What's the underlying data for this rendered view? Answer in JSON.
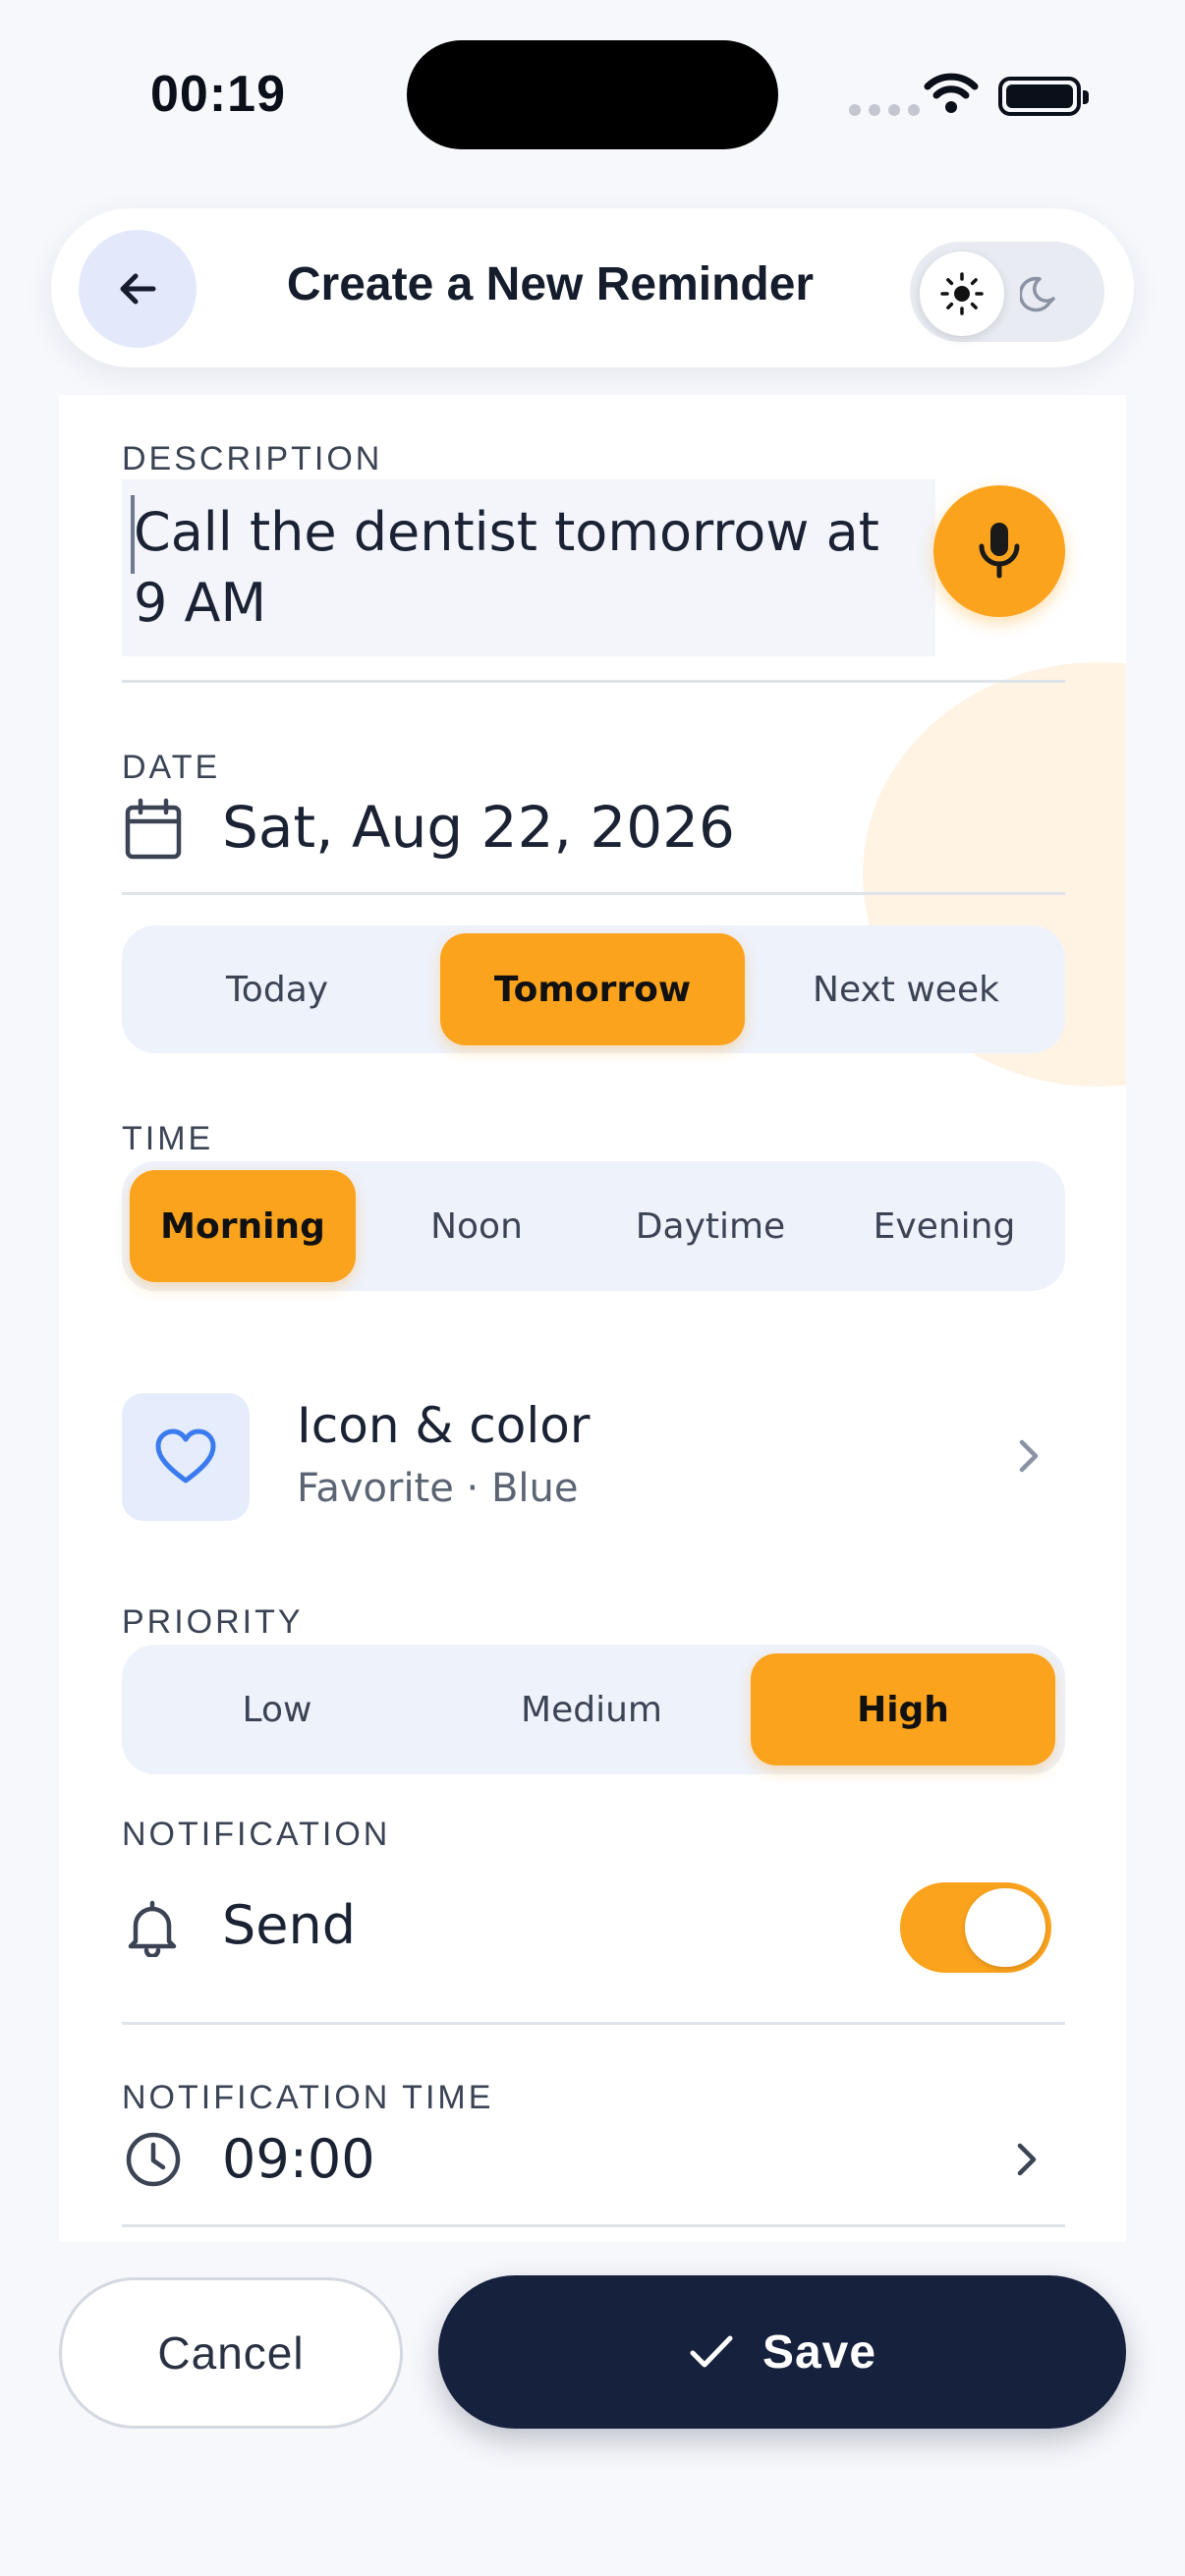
{
  "status_bar": {
    "time": "00:19"
  },
  "header": {
    "title": "Create a New Reminder"
  },
  "description": {
    "label": "DESCRIPTION",
    "value": "Call the dentist tomorrow at 9 AM"
  },
  "date": {
    "label": "DATE",
    "value": "Sat, Aug 22, 2026",
    "quick_options": [
      "Today",
      "Tomorrow",
      "Next week"
    ],
    "selected": "Tomorrow"
  },
  "time": {
    "label": "TIME",
    "options": [
      "Morning",
      "Noon",
      "Daytime",
      "Evening"
    ],
    "selected": "Morning"
  },
  "icon_color": {
    "title": "Icon & color",
    "subtitle": "Favorite · Blue"
  },
  "priority": {
    "label": "PRIORITY",
    "options": [
      "Low",
      "Medium",
      "High"
    ],
    "selected": "High"
  },
  "notification": {
    "label": "NOTIFICATION",
    "value": "Send",
    "enabled": true
  },
  "notification_time": {
    "label": "NOTIFICATION TIME",
    "value": "09:00"
  },
  "actions": {
    "cancel": "Cancel",
    "save": "Save"
  },
  "colors": {
    "accent": "#fba31d",
    "primary_dark": "#16213d",
    "icon_blue": "#3a7bf0"
  }
}
